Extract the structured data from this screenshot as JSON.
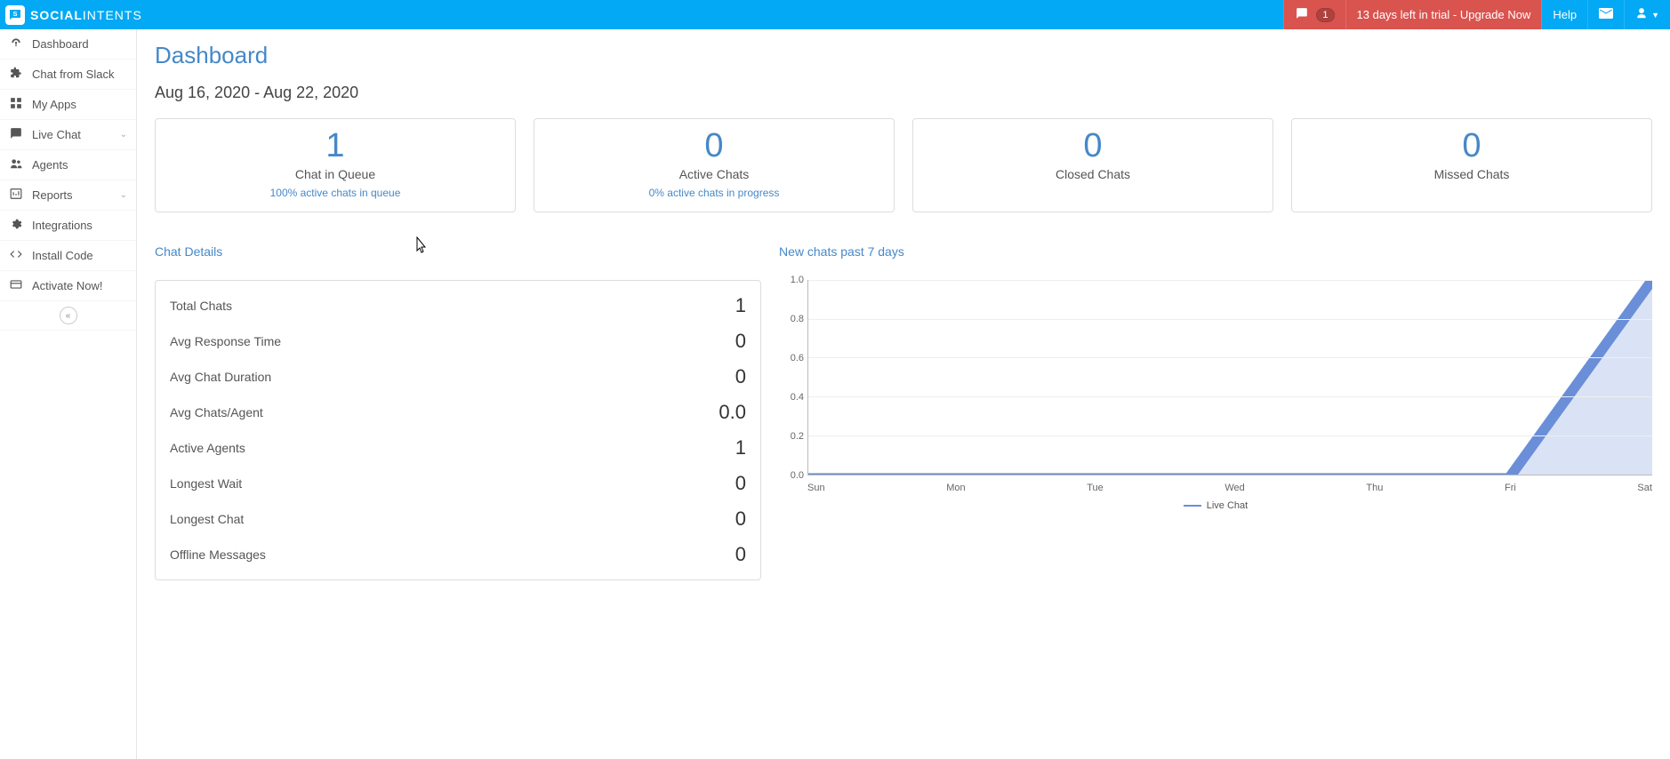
{
  "brand": {
    "part1": "SOCIAL",
    "part2": "INTENTS"
  },
  "topbar": {
    "notif_count": "1",
    "trial_text": "13 days left in trial - Upgrade Now",
    "help": "Help"
  },
  "sidebar": {
    "items": [
      {
        "label": "Dashboard",
        "icon": "dash",
        "expandable": false
      },
      {
        "label": "Chat from Slack",
        "icon": "puzzle",
        "expandable": false
      },
      {
        "label": "My Apps",
        "icon": "grid",
        "expandable": false
      },
      {
        "label": "Live Chat",
        "icon": "chat",
        "expandable": true
      },
      {
        "label": "Agents",
        "icon": "users",
        "expandable": false
      },
      {
        "label": "Reports",
        "icon": "chart",
        "expandable": true
      },
      {
        "label": "Integrations",
        "icon": "cog",
        "expandable": false
      },
      {
        "label": "Install Code",
        "icon": "code",
        "expandable": false
      },
      {
        "label": "Activate Now!",
        "icon": "card",
        "expandable": false
      }
    ]
  },
  "page": {
    "title": "Dashboard",
    "date_range": "Aug 16, 2020 - Aug 22, 2020"
  },
  "stats": [
    {
      "value": "1",
      "label": "Chat in Queue",
      "sub": "100% active chats in queue"
    },
    {
      "value": "0",
      "label": "Active Chats",
      "sub": "0% active chats in progress"
    },
    {
      "value": "0",
      "label": "Closed Chats",
      "sub": ""
    },
    {
      "value": "0",
      "label": "Missed Chats",
      "sub": ""
    }
  ],
  "details": {
    "title": "Chat Details",
    "rows": [
      {
        "label": "Total Chats",
        "value": "1"
      },
      {
        "label": "Avg Response Time",
        "value": "0"
      },
      {
        "label": "Avg Chat Duration",
        "value": "0"
      },
      {
        "label": "Avg Chats/Agent",
        "value": "0.0"
      },
      {
        "label": "Active Agents",
        "value": "1"
      },
      {
        "label": "Longest Wait",
        "value": "0"
      },
      {
        "label": "Longest Chat",
        "value": "0"
      },
      {
        "label": "Offline Messages",
        "value": "0"
      }
    ]
  },
  "chart_section_title": "New chats past 7 days",
  "chart_data": {
    "type": "area",
    "categories": [
      "Sun",
      "Mon",
      "Tue",
      "Wed",
      "Thu",
      "Fri",
      "Sat"
    ],
    "series": [
      {
        "name": "Live Chat",
        "values": [
          0,
          0,
          0,
          0,
          0,
          0,
          1
        ]
      }
    ],
    "ylim": [
      0,
      1.0
    ],
    "yticks": [
      0.0,
      0.2,
      0.4,
      0.6,
      0.8,
      1.0
    ]
  },
  "icons": {
    "dash": "◉",
    "puzzle": "🧩",
    "grid": "▦",
    "chat": "💬",
    "users": "👥",
    "chart": "⬙",
    "cog": "⚙",
    "code": "</>",
    "card": "💳"
  }
}
